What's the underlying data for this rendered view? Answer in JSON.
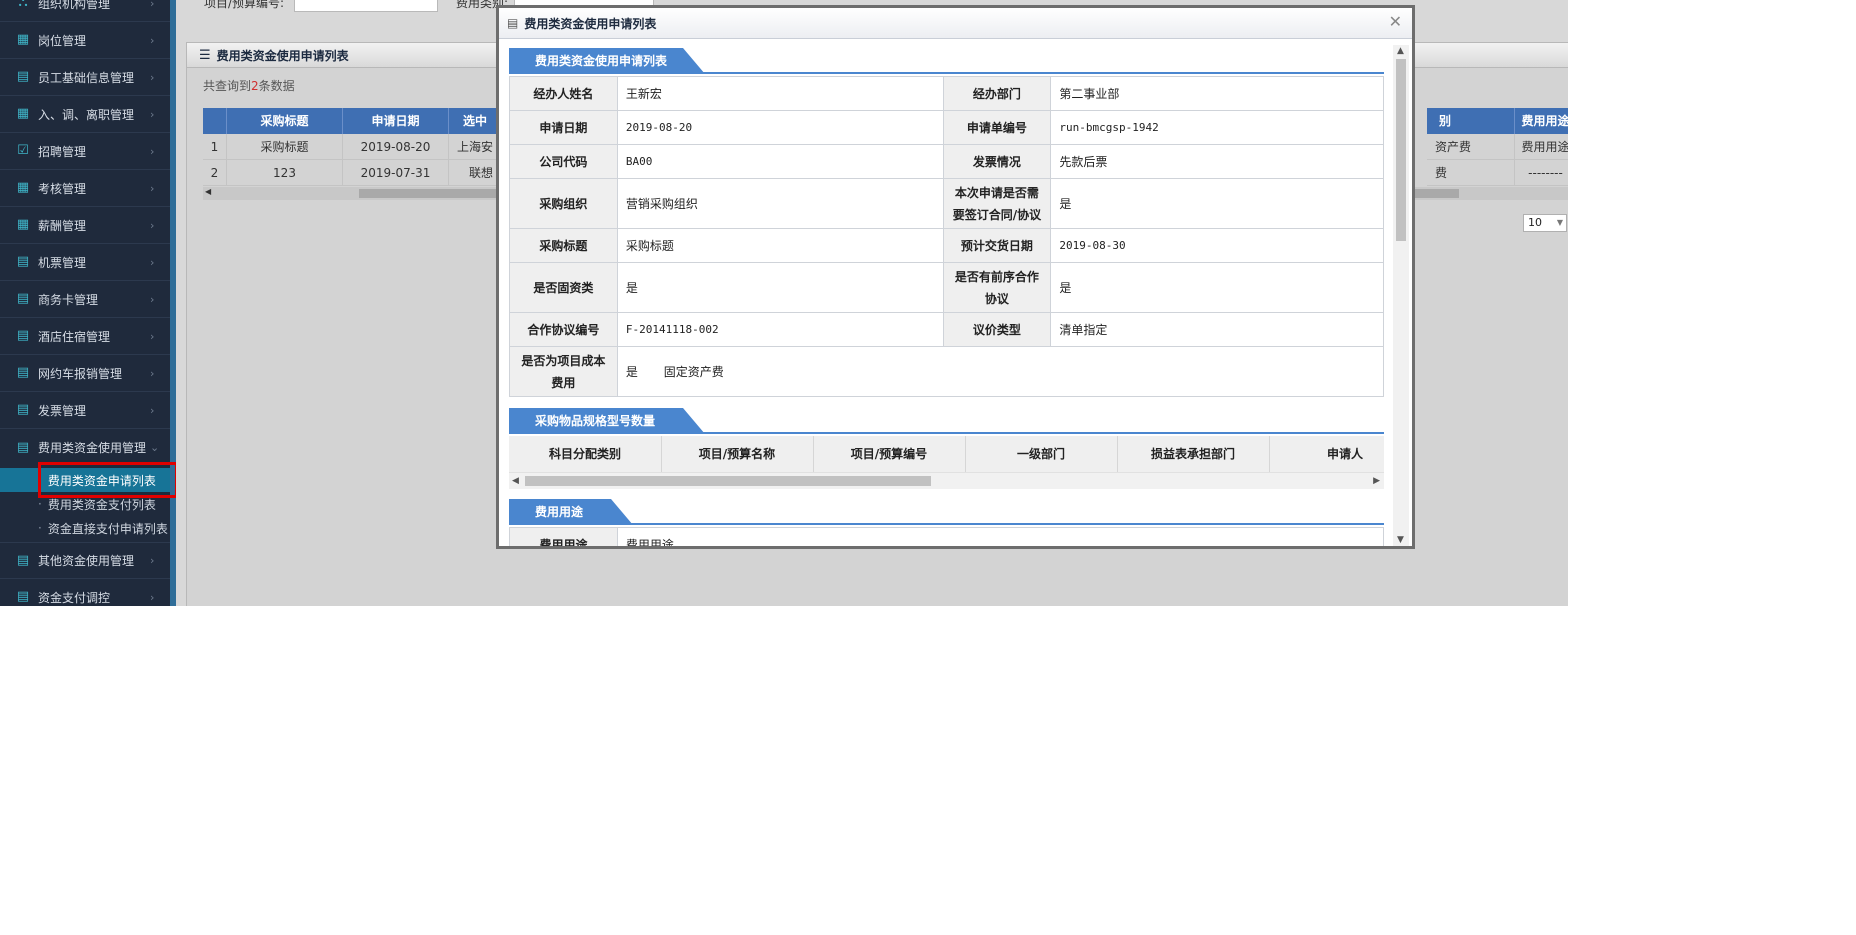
{
  "sidebar": {
    "items": [
      {
        "label": "组织机构管理",
        "icon": "org-icon"
      },
      {
        "label": "岗位管理",
        "icon": "calendar-icon"
      },
      {
        "label": "员工基础信息管理",
        "icon": "document-icon"
      },
      {
        "label": "入、调、离职管理",
        "icon": "calendar-icon"
      },
      {
        "label": "招聘管理",
        "icon": "check-calendar-icon"
      },
      {
        "label": "考核管理",
        "icon": "calendar-icon"
      },
      {
        "label": "薪酬管理",
        "icon": "calendar-icon"
      },
      {
        "label": "机票管理",
        "icon": "document-icon"
      },
      {
        "label": "商务卡管理",
        "icon": "document-icon"
      },
      {
        "label": "酒店住宿管理",
        "icon": "document-icon"
      },
      {
        "label": "网约车报销管理",
        "icon": "document-icon"
      },
      {
        "label": "发票管理",
        "icon": "document-icon"
      },
      {
        "label": "费用类资金使用管理",
        "icon": "document-icon"
      },
      {
        "label": "其他资金使用管理",
        "icon": "document-icon"
      },
      {
        "label": "资金支付调控",
        "icon": "document-icon"
      }
    ],
    "sub_items": [
      {
        "label": "费用类资金申请列表"
      },
      {
        "label": "费用类资金支付列表"
      },
      {
        "label": "资金直接支付申请列表"
      }
    ]
  },
  "main": {
    "filter": {
      "project_label": "项目/预算编号:",
      "type_label": "费用类别:"
    },
    "panel_title": "费用类资金使用申请列表",
    "count_prefix": "共查询到",
    "count_value": "2",
    "count_suffix": "条数据",
    "grid": {
      "headers": [
        "采购标题",
        "申请日期",
        "选中",
        "别",
        "费用用途"
      ],
      "rows": [
        [
          "采购标题",
          "2019-08-20",
          "上海安",
          "资产费",
          "费用用途"
        ],
        [
          "123",
          "2019-07-31",
          "联想",
          "费",
          "--------"
        ]
      ]
    },
    "page_size": "10"
  },
  "modal": {
    "title": "费用类资金使用申请列表",
    "section1": {
      "title": "费用类资金使用申请列表",
      "rows": [
        {
          "l1": "经办人姓名",
          "v1": "王新宏",
          "l2": "经办部门",
          "v2": "第二事业部"
        },
        {
          "l1": "申请日期",
          "v1": "2019-08-20",
          "l2": "申请单编号",
          "v2": "run-bmcgsp-1942"
        },
        {
          "l1": "公司代码",
          "v1": "BA00",
          "l2": "发票情况",
          "v2": "先款后票"
        },
        {
          "l1": "采购组织",
          "v1": "营销采购组织",
          "l2": "本次申请是否需要签订合同/协议",
          "v2": "是"
        },
        {
          "l1": "采购标题",
          "v1": "采购标题",
          "l2": "预计交货日期",
          "v2": "2019-08-30"
        },
        {
          "l1": "是否固资类",
          "v1": "是",
          "l2": "是否有前序合作协议",
          "v2": "是"
        },
        {
          "l1": "合作协议编号",
          "v1": "F-20141118-002",
          "l2": "议价类型",
          "v2": "清单指定"
        },
        {
          "l1": "是否为项目成本费用",
          "v1": "是",
          "v1b": "固定资产费"
        }
      ]
    },
    "section2": {
      "title": "采购物品规格型号数量",
      "headers": [
        "科目分配类别",
        "项目/预算名称",
        "项目/预算编号",
        "一级部门",
        "损益表承担部门",
        "申请人"
      ]
    },
    "section3": {
      "title": "费用用途",
      "label": "费用用途",
      "value": "费用用途"
    }
  },
  "colors": {
    "sidebar_bg": "#1f2a3c",
    "accent": "#4a86cf",
    "highlight": "#e00000",
    "active_sub": "#177497"
  }
}
